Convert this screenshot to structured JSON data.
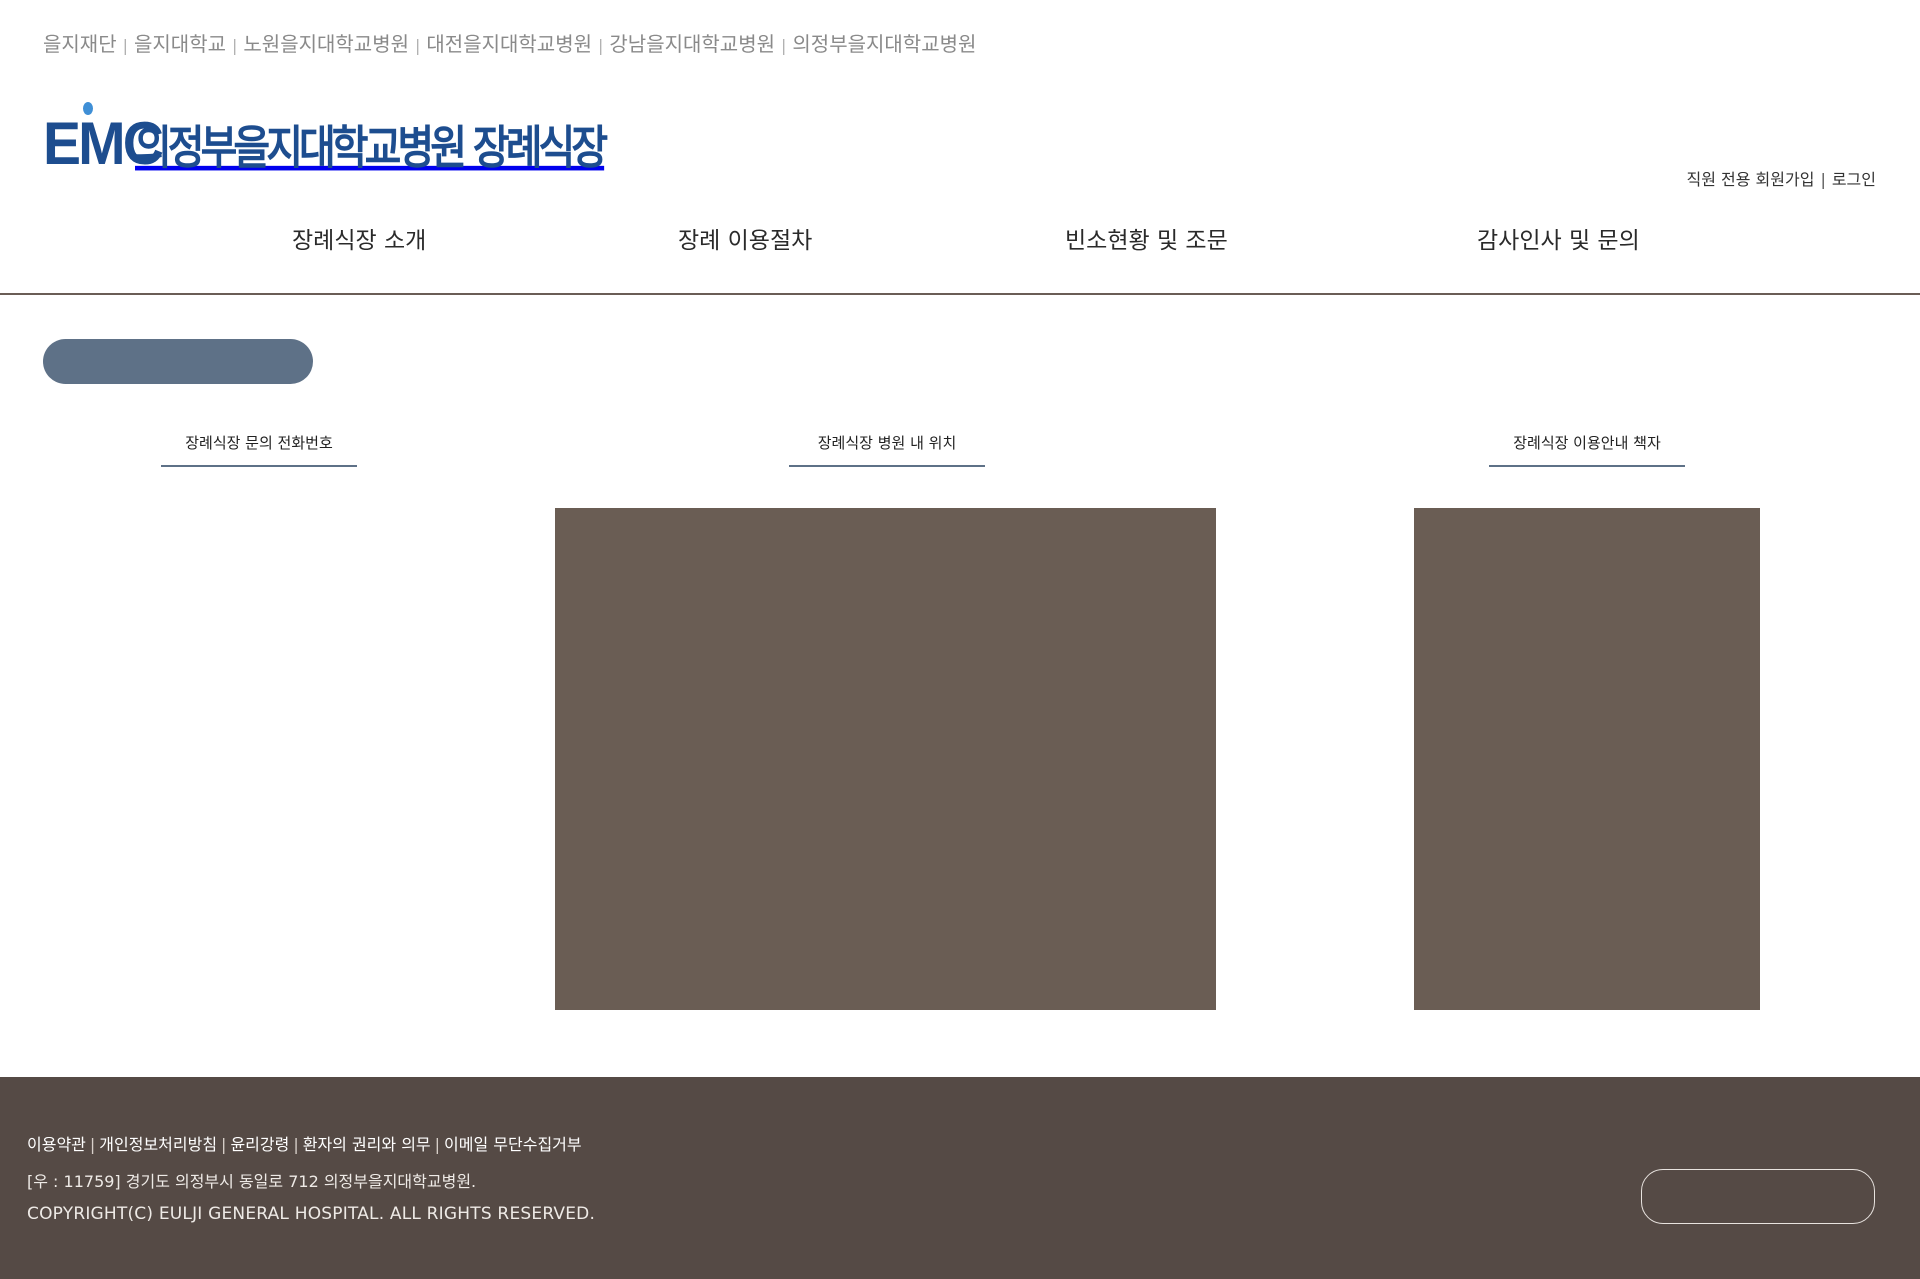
{
  "top_links": [
    "을지재단",
    "을지대학교",
    "노원을지대학교병원",
    "대전을지대학교병원",
    "강남을지대학교병원",
    "의정부을지대학교병원"
  ],
  "top_links_separator": "|",
  "logo": {
    "mark": "EMC",
    "text": "의정부을지대학교병원 장례식장",
    "color": "#1d4d8f"
  },
  "member_links": {
    "signup": "직원 전용 회원가입",
    "separator": "|",
    "login": "로그인"
  },
  "nav": [
    "장례식장 소개",
    "장례 이용절차",
    "빈소현황 및 조문",
    "감사인사 및 문의"
  ],
  "columns": [
    {
      "title": "장례식장 문의 전화번호"
    },
    {
      "title": "장례식장 병원 내 위치"
    },
    {
      "title": "장례식장 이용안내 책자"
    }
  ],
  "footer": {
    "links": [
      "이용약관",
      "개인정보처리방침",
      "윤리강령",
      "환자의 권리와 의무",
      "이메일 무단수집거부"
    ],
    "separator": "|",
    "address": "[우 : 11759] 경기도 의정부시 동일로 712 의정부을지대학교병원.",
    "copyright": "COPYRIGHT(C) EULJI GENERAL HOSPITAL. ALL RIGHTS RESERVED."
  },
  "colors": {
    "accent": "#5e7187",
    "image_placeholder": "#6a5d54",
    "footer_bg": "#554a45",
    "nav_rule": "#6a5d56"
  }
}
